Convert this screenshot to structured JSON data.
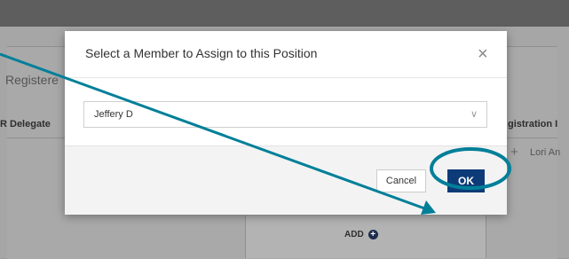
{
  "background": {
    "registered_partial": "Registere",
    "left_column_partial": "R Delegate",
    "right_column_partial": "gistration I",
    "name_partial": "Lori An",
    "add_label": "ADD"
  },
  "modal": {
    "title": "Select a Member to Assign to this Position",
    "close_glyph": "×",
    "member_select": {
      "value": "Jeffery D"
    },
    "cancel_label": "Cancel",
    "ok_label": "OK"
  },
  "annotation": {
    "color": "#007f99",
    "target": "ok-button"
  },
  "colors": {
    "primary_button": "#0d3b78",
    "overlay": "#9b9b9b",
    "modal_footer": "#f3f3f3"
  }
}
